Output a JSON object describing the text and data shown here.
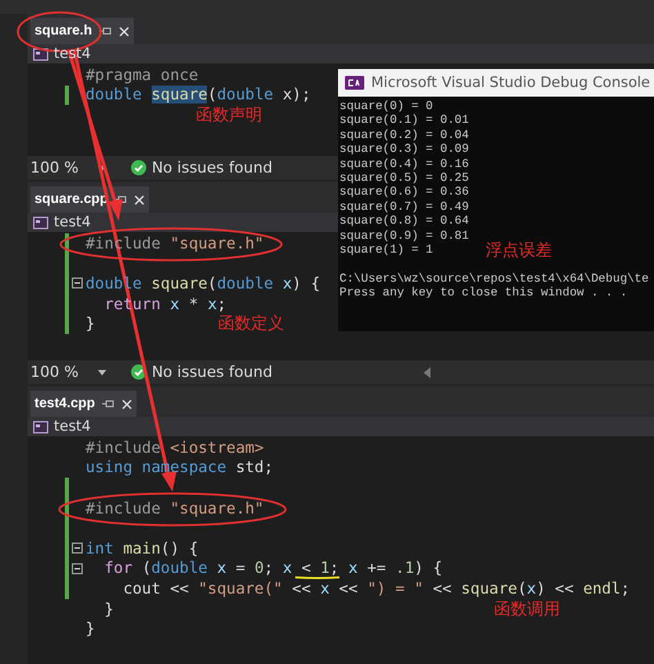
{
  "panes": [
    {
      "tab": {
        "label": "square.h",
        "selected": true
      },
      "project": "test4",
      "lines": [
        {
          "changed": false,
          "fold": false,
          "tokens": [
            {
              "kind": "pp",
              "text": "#pragma once"
            }
          ]
        },
        {
          "changed": true,
          "fold": false,
          "tokens": [
            {
              "kind": "kw",
              "text": "double "
            },
            {
              "kind": "fn",
              "text": "square",
              "highlighted": true
            },
            {
              "kind": "txt",
              "text": "("
            },
            {
              "kind": "kw",
              "text": "double"
            },
            {
              "kind": "txt",
              "text": " x);"
            }
          ]
        },
        {
          "changed": false,
          "fold": false,
          "note": "函数声明"
        }
      ],
      "status": {
        "zoom": "100 %",
        "issues": "No issues found"
      }
    },
    {
      "tab": {
        "label": "square.cpp",
        "selected": true
      },
      "project": "test4",
      "lines": [
        {
          "changed": true,
          "fold": false,
          "tokens": [
            {
              "kind": "pp",
              "text": "#include"
            },
            {
              "kind": "str",
              "text": " \"square.h\""
            }
          ]
        },
        {
          "changed": true,
          "fold": false
        },
        {
          "changed": true,
          "fold": true,
          "tokens": [
            {
              "kind": "kw",
              "text": "double"
            },
            {
              "kind": "fn",
              "text": " square"
            },
            {
              "kind": "txt",
              "text": "("
            },
            {
              "kind": "kw",
              "text": "double"
            },
            {
              "kind": "var",
              "text": " x"
            },
            {
              "kind": "txt",
              "text": ") {"
            }
          ]
        },
        {
          "changed": true,
          "fold": false,
          "tokens": [
            {
              "kind": "ctl",
              "text": "  return"
            },
            {
              "kind": "var",
              "text": " x"
            },
            {
              "kind": "txt",
              "text": " * "
            },
            {
              "kind": "var",
              "text": "x"
            },
            {
              "kind": "txt",
              "text": ";"
            }
          ]
        },
        {
          "changed": true,
          "fold": false,
          "tokens": [
            {
              "kind": "txt",
              "text": "}"
            }
          ],
          "note": "函数定义"
        }
      ],
      "status": {
        "zoom": "100 %",
        "issues": "No issues found"
      }
    },
    {
      "tab": {
        "label": "test4.cpp",
        "selected": true
      },
      "project": "test4",
      "lines": [
        {
          "changed": false,
          "fold": false,
          "tokens": [
            {
              "kind": "pp",
              "text": "#include"
            },
            {
              "kind": "str",
              "text": " <iostream>"
            }
          ]
        },
        {
          "changed": false,
          "fold": false,
          "tokens": [
            {
              "kind": "kw",
              "text": "using namespace"
            },
            {
              "kind": "txt",
              "text": " std;"
            }
          ]
        },
        {
          "changed": true,
          "fold": false
        },
        {
          "changed": true,
          "fold": false,
          "tokens": [
            {
              "kind": "pp",
              "text": "#include"
            },
            {
              "kind": "str",
              "text": " \"square.h\""
            }
          ]
        },
        {
          "changed": true,
          "fold": false
        },
        {
          "changed": true,
          "fold": true,
          "tokens": [
            {
              "kind": "kw",
              "text": "int"
            },
            {
              "kind": "fn",
              "text": " main"
            },
            {
              "kind": "txt",
              "text": "() {"
            }
          ]
        },
        {
          "changed": true,
          "fold": true,
          "tokens": [
            {
              "kind": "ctl",
              "text": "  for"
            },
            {
              "kind": "txt",
              "text": " ("
            },
            {
              "kind": "kw",
              "text": "double"
            },
            {
              "kind": "var",
              "text": " x"
            },
            {
              "kind": "txt",
              "text": " = "
            },
            {
              "kind": "num",
              "text": "0"
            },
            {
              "kind": "txt",
              "text": "; "
            },
            {
              "kind": "var",
              "text": "x"
            },
            {
              "kind": "txt",
              "text": " < "
            },
            {
              "kind": "num",
              "text": "1"
            },
            {
              "kind": "txt",
              "text": "; "
            },
            {
              "kind": "var",
              "text": "x"
            },
            {
              "kind": "txt",
              "text": " += "
            },
            {
              "kind": "num",
              "text": ".1"
            },
            {
              "kind": "txt",
              "text": ") {"
            }
          ]
        },
        {
          "changed": true,
          "fold": false,
          "tokens": [
            {
              "kind": "txt",
              "text": "    cout << "
            },
            {
              "kind": "str",
              "text": "\"square(\""
            },
            {
              "kind": "txt",
              "text": " << "
            },
            {
              "kind": "var",
              "text": "x"
            },
            {
              "kind": "txt",
              "text": " << "
            },
            {
              "kind": "str",
              "text": "\") = \""
            },
            {
              "kind": "txt",
              "text": " << "
            },
            {
              "kind": "fn",
              "text": "square"
            },
            {
              "kind": "txt",
              "text": "("
            },
            {
              "kind": "var",
              "text": "x"
            },
            {
              "kind": "txt",
              "text": ") << "
            },
            {
              "kind": "fn",
              "text": "endl"
            },
            {
              "kind": "txt",
              "text": ";"
            }
          ]
        },
        {
          "changed": false,
          "fold": false,
          "tokens": [
            {
              "kind": "txt",
              "text": "  }"
            }
          ],
          "note": "函数调用"
        },
        {
          "changed": false,
          "fold": false,
          "tokens": [
            {
              "kind": "txt",
              "text": "}"
            }
          ]
        }
      ]
    }
  ],
  "console": {
    "title": "Microsoft Visual Studio Debug Console",
    "output": [
      {
        "text": "square(0) = 0"
      },
      {
        "text": "square(0.1) = 0.01"
      },
      {
        "text": "square(0.2) = 0.04"
      },
      {
        "text": "square(0.3) = 0.09"
      },
      {
        "text": "square(0.4) = 0.16"
      },
      {
        "text": "square(0.5) = 0.25"
      },
      {
        "text": "square(0.6) = 0.36"
      },
      {
        "text": "square(0.7) = 0.49"
      },
      {
        "text": "square(0.8) = 0.64"
      },
      {
        "text": "square(0.9) = 0.81"
      },
      {
        "text": "square(1) = 1",
        "note": "浮点误差"
      }
    ],
    "prompt": [
      "C:\\Users\\wz\\source\\repos\\test4\\x64\\Debug\\te",
      "Press any key to close this window . . ."
    ]
  }
}
